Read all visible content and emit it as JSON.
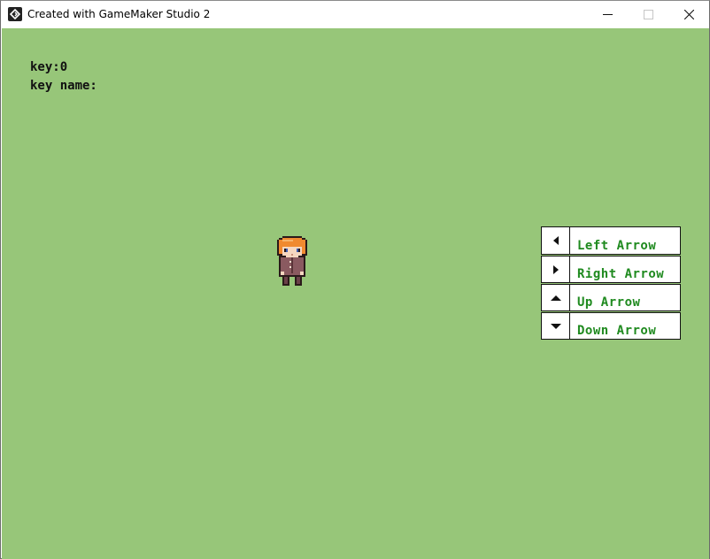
{
  "window": {
    "title": "Created with GameMaker Studio 2",
    "controls": {
      "minimize": "—",
      "maximize": "☐",
      "close": "✕"
    }
  },
  "hud": {
    "key_line": "key:0",
    "key_name_line": "key name:"
  },
  "legend": {
    "items": [
      {
        "icon": "left-triangle-icon",
        "label": "Left Arrow"
      },
      {
        "icon": "right-triangle-icon",
        "label": "Right Arrow"
      },
      {
        "icon": "up-triangle-icon",
        "label": "Up Arrow"
      },
      {
        "icon": "down-triangle-icon",
        "label": "Down Arrow"
      }
    ]
  },
  "colors": {
    "background": "#97c679",
    "legend_text": "#1f8a1f",
    "hud_text": "#111111"
  }
}
